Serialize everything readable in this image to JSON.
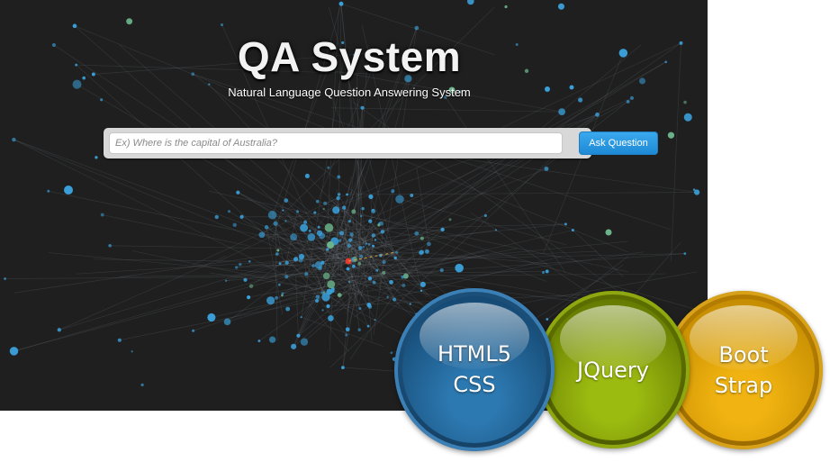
{
  "hero": {
    "title": "QA System",
    "subtitle": "Natural Language Question Answering System"
  },
  "search": {
    "placeholder": "Ex) Where is the capital of Australia?",
    "value": "",
    "button_label": "Ask Question"
  },
  "orbs": [
    {
      "line1": "HTML5",
      "line2": "CSS",
      "color": "#1b4f78"
    },
    {
      "line1": "JQuery",
      "color": "#6b7f00"
    },
    {
      "line1": "Boot",
      "line2": "Strap",
      "color": "#c28a00"
    }
  ],
  "colors": {
    "background": "#1f1f1f",
    "node_blue": "#3a9fd8",
    "node_green": "#6bb38a",
    "center_node": "#e63a2e",
    "accent_button": "#2a97e0"
  }
}
